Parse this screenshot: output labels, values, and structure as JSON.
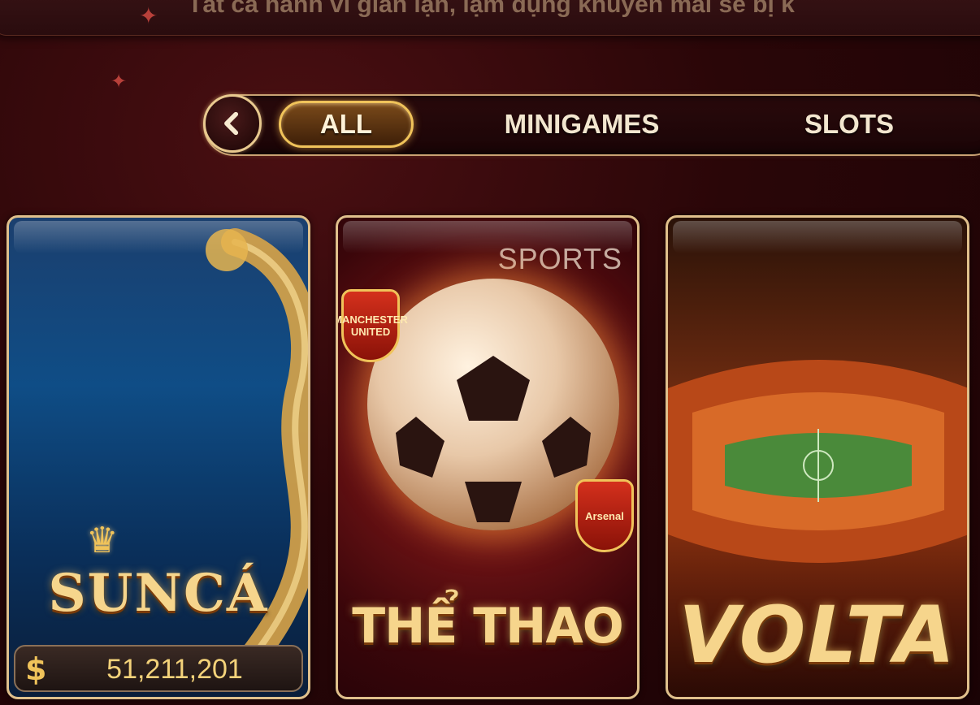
{
  "marquee": {
    "text": "Tất cả hành vi gian lận, lạm dụng khuyến mãi sẽ bị k"
  },
  "tabs": [
    {
      "label": "ALL",
      "active": true
    },
    {
      "label": "MINIGAMES",
      "active": false
    },
    {
      "label": "SLOTS",
      "active": false
    }
  ],
  "games": [
    {
      "title": "SUNCÁ",
      "jackpot": "51,211,201",
      "jackpot_icon": "dollar-icon"
    },
    {
      "title": "THỂ THAO",
      "logo": "SPORTS",
      "badges": [
        "MANCHESTER UNITED",
        "Arsenal"
      ]
    },
    {
      "title": "VOLTA"
    }
  ],
  "colors": {
    "accent": "#f0c35a",
    "background": "#2a0608",
    "tab_border": "#c9a273"
  }
}
